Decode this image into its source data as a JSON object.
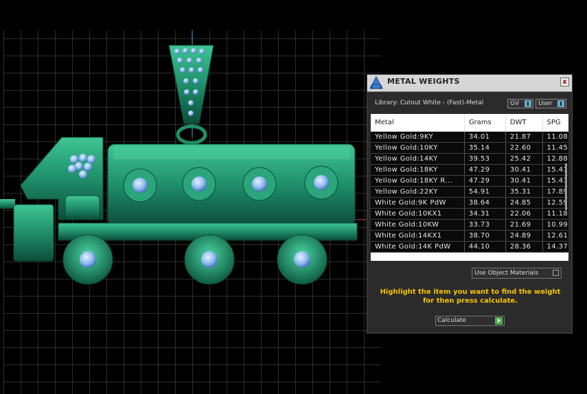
{
  "panel": {
    "title": "METAL WEIGHTS",
    "close_label": "x",
    "library": "Library: Cutout White - (Fast)-Metal",
    "gv_label": "GV",
    "user_label": "User",
    "columns": [
      "Metal",
      "Grams",
      "DWT",
      "SPG"
    ],
    "rows": [
      [
        "Yellow Gold:9KY",
        "34.01",
        "21.87",
        "11.08"
      ],
      [
        "Yellow Gold:10KY",
        "35.14",
        "22.60",
        "11.45"
      ],
      [
        "Yellow Gold:14KY",
        "39.53",
        "25.42",
        "12.88"
      ],
      [
        "Yellow Gold:18KY",
        "47.29",
        "30.41",
        "15.41"
      ],
      [
        "Yellow Gold:18KY R...",
        "47.29",
        "30.41",
        "15.41"
      ],
      [
        "Yellow Gold:22KY",
        "54.91",
        "35.31",
        "17.89"
      ],
      [
        "White Gold:9K PdW",
        "38.64",
        "24.85",
        "12.59"
      ],
      [
        "White Gold:10KX1",
        "34.31",
        "22.06",
        "11.18"
      ],
      [
        "White Gold:10KW",
        "33.73",
        "21.69",
        "10.99"
      ],
      [
        "White Gold:14KX1",
        "38.70",
        "24.89",
        "12.61"
      ],
      [
        "White Gold:14K PdW",
        "44.10",
        "28.36",
        "14.37"
      ]
    ],
    "use_object_materials": "Use Object Materials",
    "hint": "Highlight the item you want to find the weight for then press calculate.",
    "calculate_label": "Calculate"
  },
  "colors": {
    "metal_green": "#1f8f6a",
    "gem_blue": "#8ab8ee",
    "grid": "#5a5a5a",
    "hint_yellow": "#f5c400"
  }
}
